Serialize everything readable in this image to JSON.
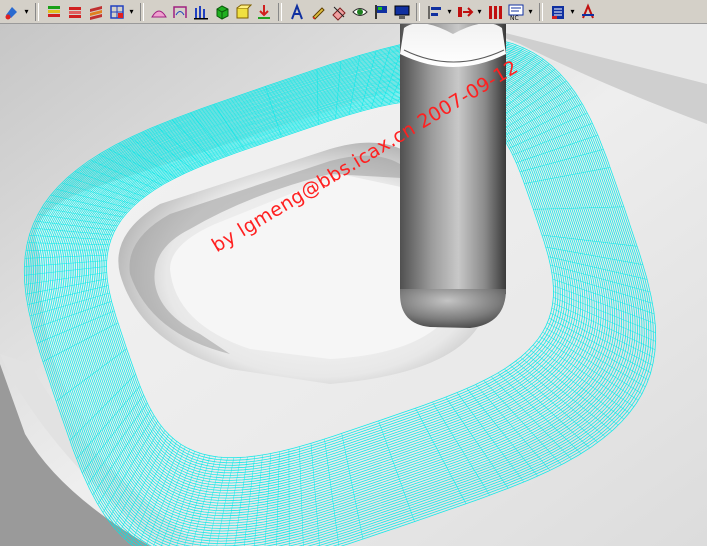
{
  "toolbar": {
    "buttons": [
      {
        "icon": "paint-icon",
        "dropdown": true
      },
      {
        "icon": "layer-stack-icon",
        "dropdown": false
      },
      {
        "icon": "layer-red-icon",
        "dropdown": false
      },
      {
        "icon": "layer-strata-icon",
        "dropdown": false
      },
      {
        "icon": "boundary-grid-icon",
        "dropdown": true
      },
      {
        "icon": "surface-pink-icon",
        "dropdown": false
      },
      {
        "icon": "surface-frame-icon",
        "dropdown": false
      },
      {
        "icon": "bars-chart-icon",
        "dropdown": false
      },
      {
        "icon": "green-cube-icon",
        "dropdown": false
      },
      {
        "icon": "yellow-box-icon",
        "dropdown": false
      },
      {
        "icon": "toolpath-down-icon",
        "dropdown": false
      },
      {
        "icon": "text-a-icon",
        "dropdown": false
      },
      {
        "icon": "pencil-icon",
        "dropdown": false
      },
      {
        "icon": "eraser-icon",
        "dropdown": false
      },
      {
        "icon": "eye-icon",
        "dropdown": false
      },
      {
        "icon": "flag-icon",
        "dropdown": false
      },
      {
        "icon": "monitor-icon",
        "dropdown": false
      },
      {
        "icon": "align-icon",
        "dropdown": true
      },
      {
        "icon": "arrow-right-icon",
        "dropdown": true
      },
      {
        "icon": "columns-icon",
        "dropdown": false
      },
      {
        "icon": "nc-program-icon",
        "dropdown": true
      },
      {
        "icon": "list-icon",
        "dropdown": true
      },
      {
        "icon": "axis-icon",
        "dropdown": false
      }
    ]
  },
  "watermark": {
    "text": "by lgmeng@bbs.icax.cn 2007-09-12"
  },
  "colors": {
    "toolpath": "#00e8e8",
    "watermark": "#ff2020",
    "toolbar": "#d4d0c8"
  }
}
